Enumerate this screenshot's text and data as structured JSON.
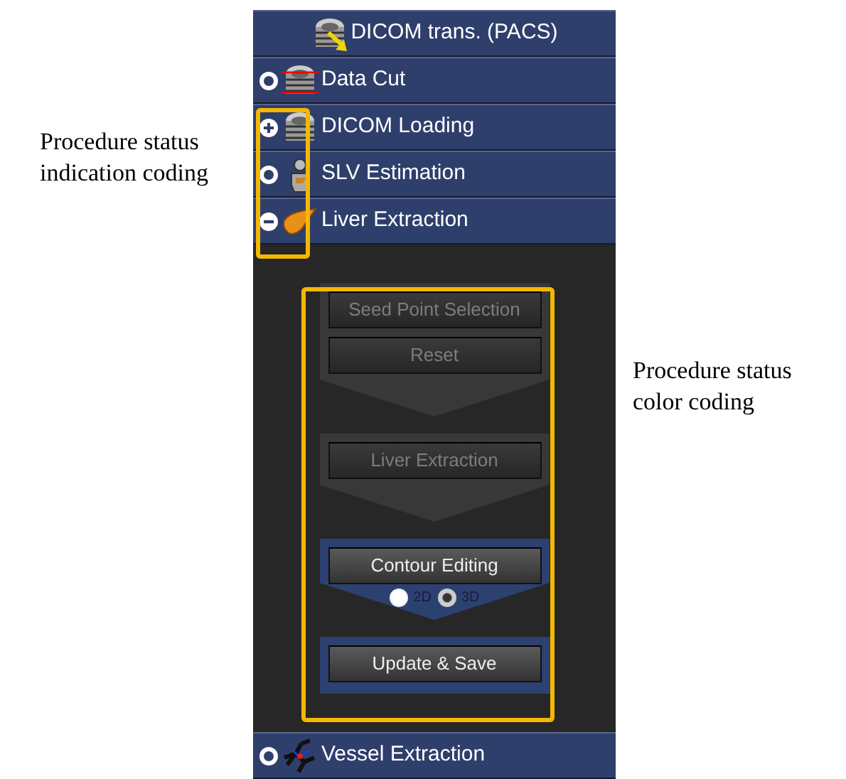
{
  "annotations": {
    "left": "Procedure status indication coding",
    "right": "Procedure status color coding"
  },
  "headers": [
    {
      "label": "DICOM trans. (PACS)",
      "kind": "transfer"
    },
    {
      "label": "Data Cut",
      "kind": "cut",
      "expandable": false
    },
    {
      "label": "DICOM Loading",
      "kind": "stack",
      "expandable": true,
      "expanded": false
    },
    {
      "label": "SLV Estimation",
      "kind": "body",
      "expandable": false
    },
    {
      "label": "Liver Extraction",
      "kind": "liver",
      "expandable": true,
      "expanded": true
    }
  ],
  "step_groups": [
    {
      "active": false,
      "chevron": true,
      "buttons": [
        "Seed Point Selection",
        "Reset"
      ]
    },
    {
      "active": false,
      "chevron": true,
      "buttons": [
        "Liver Extraction"
      ]
    },
    {
      "active": true,
      "chevron": true,
      "buttons": [
        "Contour Editing"
      ],
      "options": [
        {
          "label": "2D",
          "selected": false
        },
        {
          "label": "3D",
          "selected": true
        }
      ]
    },
    {
      "active": true,
      "chevron": false,
      "buttons": [
        "Update & Save"
      ]
    }
  ],
  "footer": {
    "label": "Vessel Extraction",
    "kind": "vessel",
    "expandable": false
  }
}
